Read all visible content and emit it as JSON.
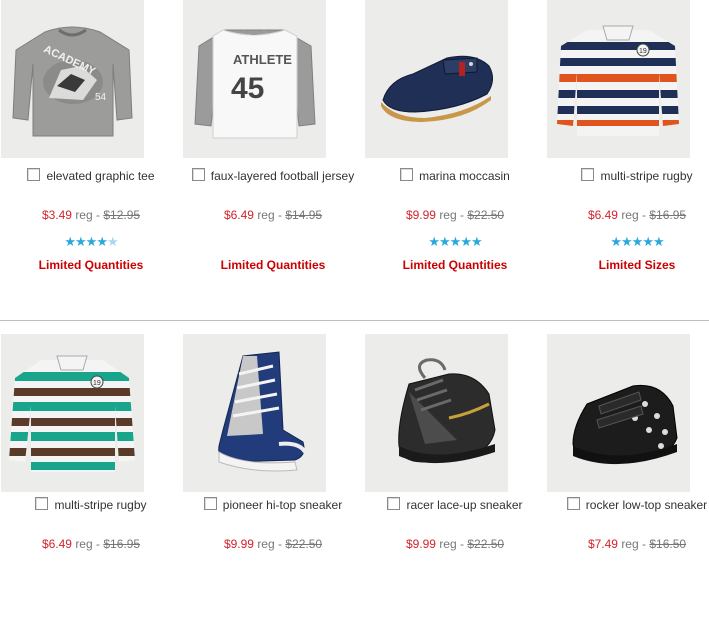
{
  "rows": [
    {
      "products": [
        {
          "name": "elevated graphic tee",
          "sale": "$3.49",
          "reg_label": "reg -",
          "orig": "$12.95",
          "rating": 4.5,
          "status": "Limited Quantities"
        },
        {
          "name": "faux-layered football jersey",
          "sale": "$6.49",
          "reg_label": "reg -",
          "orig": "$14.95",
          "rating": 0,
          "status": "Limited Quantities"
        },
        {
          "name": "marina moccasin",
          "sale": "$9.99",
          "reg_label": "reg -",
          "orig": "$22.50",
          "rating": 5,
          "status": "Limited Quantities"
        },
        {
          "name": "multi-stripe rugby",
          "sale": "$6.49",
          "reg_label": "reg -",
          "orig": "$16.95",
          "rating": 5,
          "status": "Limited Sizes"
        }
      ]
    },
    {
      "products": [
        {
          "name": "multi-stripe rugby",
          "sale": "$6.49",
          "reg_label": "reg -",
          "orig": "$16.95"
        },
        {
          "name": "pioneer hi-top sneaker",
          "sale": "$9.99",
          "reg_label": "reg -",
          "orig": "$22.50"
        },
        {
          "name": "racer lace-up sneaker",
          "sale": "$9.99",
          "reg_label": "reg -",
          "orig": "$22.50"
        },
        {
          "name": "rocker low-top sneaker",
          "sale": "$7.49",
          "reg_label": "reg -",
          "orig": "$16.50"
        }
      ]
    }
  ],
  "image_art": {
    "p1": {
      "word": "ACADEMY",
      "number": "54"
    },
    "p2": {
      "word": "ATHLETE",
      "number": "45"
    },
    "p4": {
      "badge": "19"
    },
    "p5": {
      "badge": "19"
    }
  },
  "colors": {
    "sale_price": "#d2232a",
    "status_text": "#cc0000",
    "star": "#29a8de",
    "thumb_bg": "#ececea",
    "divider": "#bdbdbd"
  }
}
